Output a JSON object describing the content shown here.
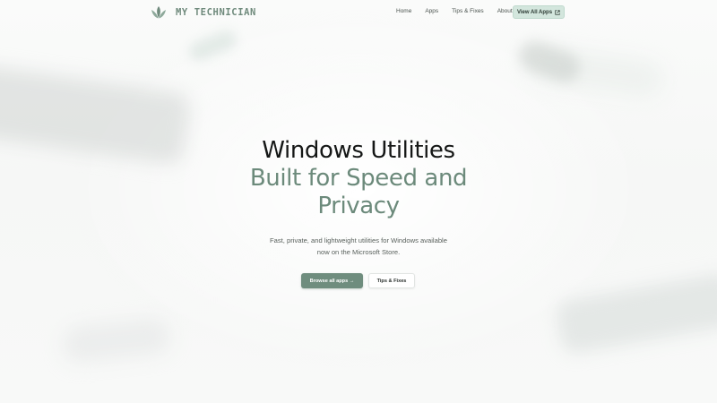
{
  "brand": {
    "name": "MY TECHNICIAN",
    "logo_icon": "leaf-logo-icon",
    "color": "#6f8a7c"
  },
  "nav": {
    "links": [
      "Home",
      "Apps",
      "Tips & Fixes",
      "About"
    ],
    "cta_label": "View All Apps",
    "cta_icon": "external-link-icon"
  },
  "hero": {
    "title_line1": "Windows Utilities",
    "title_line2": "Built for Speed and",
    "title_line3": "Privacy",
    "subtitle_line1": "Fast, private, and lightweight utilities for Windows available",
    "subtitle_line2": "now on the Microsoft Store.",
    "primary_button": "Browse all apps →",
    "secondary_button": "Tips & Fixes"
  },
  "colors": {
    "accent": "#6f8d7e",
    "accent_light": "#d3e6dd",
    "title_dark": "#151716",
    "background": "#f7f8f7"
  }
}
